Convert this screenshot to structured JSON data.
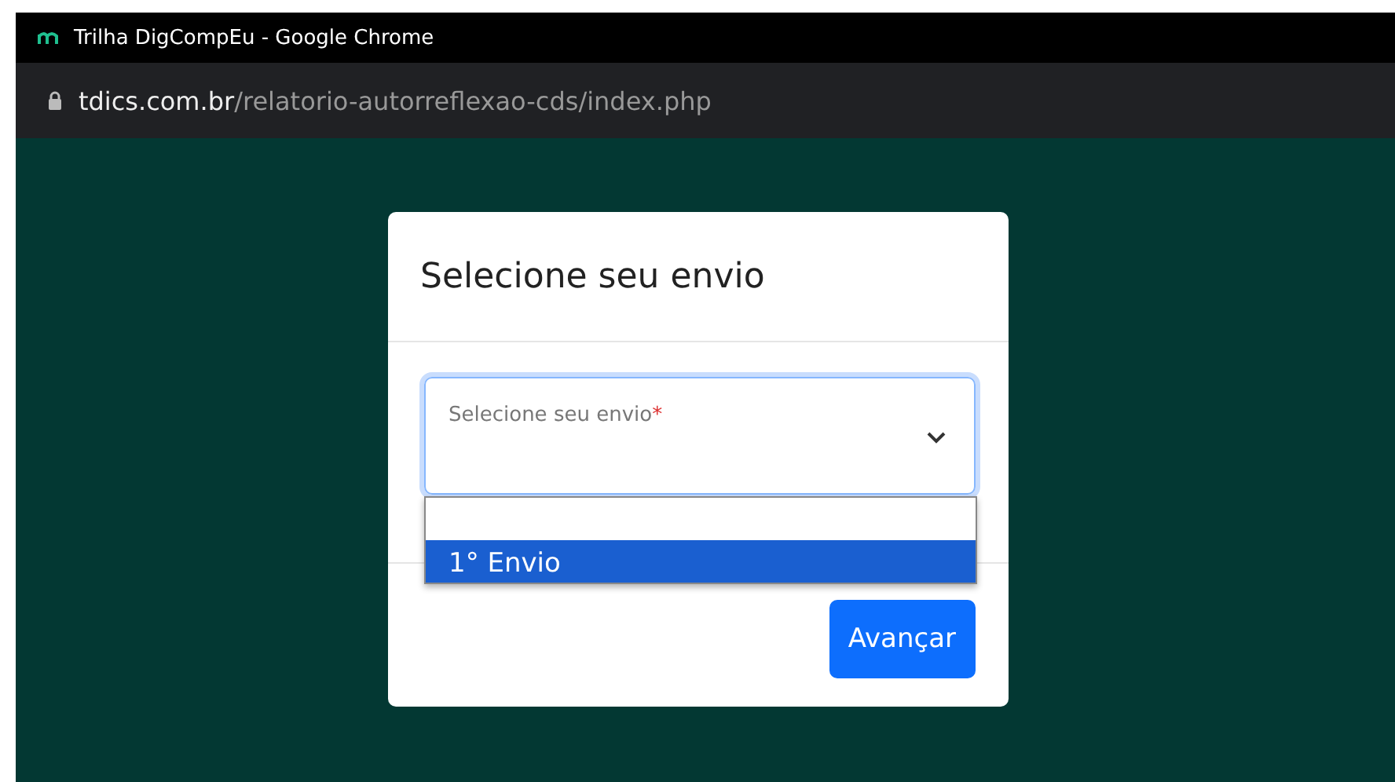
{
  "window": {
    "title": "Trilha DigCompEu - Google Chrome"
  },
  "address_bar": {
    "domain": "tdics.com.br",
    "path": "/relatorio-autorreflexao-cds/index.php"
  },
  "modal": {
    "title": "Selecione seu envio",
    "select": {
      "label": "Selecione seu envio",
      "required_mark": "*",
      "expanded": true,
      "options": [
        {
          "selected": false
        },
        {
          "label": "1° Envio",
          "selected": true
        }
      ]
    },
    "buttons": [
      "Avançar"
    ]
  }
}
